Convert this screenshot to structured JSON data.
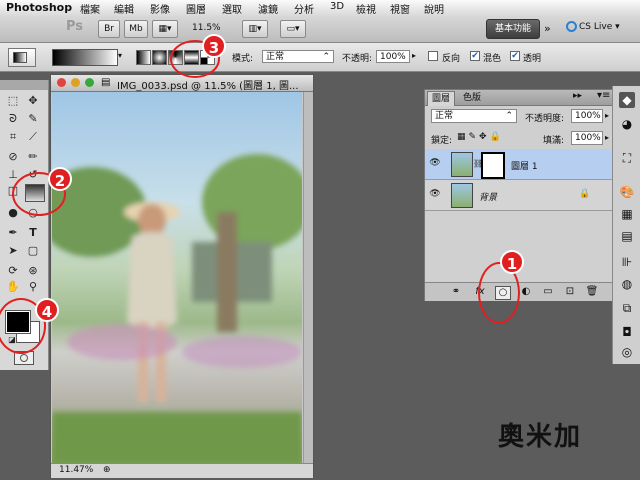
{
  "menubar": {
    "app": "Photoshop",
    "items": [
      "檔案",
      "編輯",
      "影像",
      "圖層",
      "選取",
      "濾鏡",
      "分析",
      "3D",
      "檢視",
      "視窗",
      "說明"
    ]
  },
  "appbar": {
    "logo": "Ps",
    "zoom": "11.5%",
    "workspace": "基本功能",
    "cslive": "CS Live"
  },
  "options": {
    "mode_label": "模式:",
    "mode_value": "正常",
    "opacity_label": "不透明:",
    "opacity_value": "100%",
    "reverse_label": "反向",
    "dither_label": "混色",
    "transparency_label": "透明",
    "reverse_checked": false,
    "dither_checked": true,
    "transparency_checked": true
  },
  "document": {
    "title": "IMG_0033.psd @ 11.5% (圖層 1, 圖...",
    "zoom": "11.47%"
  },
  "layers_panel": {
    "tabs": [
      "圖層",
      "色版"
    ],
    "blend_mode": "正常",
    "opacity_label": "不透明度:",
    "opacity_value": "100%",
    "lock_label": "鎖定:",
    "fill_label": "填滿:",
    "fill_value": "100%",
    "layers": [
      {
        "name": "圖層 1",
        "selected": true,
        "has_mask": true
      },
      {
        "name": "背景",
        "selected": false,
        "locked": true
      }
    ]
  },
  "callouts": [
    "1",
    "2",
    "3",
    "4"
  ],
  "watermark": "奧米加",
  "colors": {
    "callout": "#e02020",
    "selection": "#b6cff0",
    "workspace_button": "#4a4a4a"
  }
}
